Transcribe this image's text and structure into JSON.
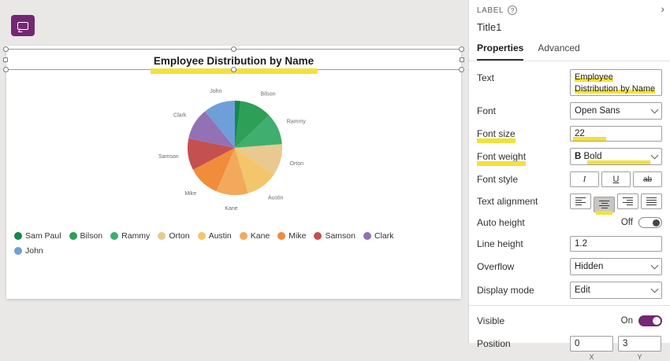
{
  "colors": {
    "accent": "#742774",
    "highlight": "#f2e13c",
    "toggle_on": "#742774"
  },
  "canvas": {
    "title": "Employee Distribution by Name"
  },
  "chart_data": {
    "type": "pie",
    "title": "Employee Distribution by Name",
    "labels": [
      "Sam Paul",
      "Bilson",
      "Rammy",
      "Orton",
      "Austin",
      "Kane",
      "Mike",
      "Samson",
      "Clark",
      "John"
    ],
    "values": [
      2,
      11,
      11,
      11,
      11,
      11,
      11,
      11,
      11,
      11
    ],
    "colors": [
      "#118a4e",
      "#2d9f57",
      "#3fae6e",
      "#e9c98f",
      "#f3c66b",
      "#f2a95c",
      "#f08c3a",
      "#c4504f",
      "#9271b5",
      "#6f9fd8"
    ],
    "legend_position": "bottom-left",
    "slice_labels_shown": [
      "Bilson",
      "Rammy",
      "Orton",
      "Austin",
      "Kane",
      "Mike",
      "Samson",
      "Clark",
      "John"
    ]
  },
  "panel": {
    "collapse_chevron": "›",
    "header": "LABEL",
    "help_icon": "?",
    "control_name": "Title1",
    "tabs": [
      {
        "label": "Properties",
        "active": true
      },
      {
        "label": "Advanced",
        "active": false
      }
    ],
    "fields": {
      "text": {
        "label": "Text",
        "value": "Employee Distribution by Name"
      },
      "font": {
        "label": "Font",
        "value": "Open Sans"
      },
      "font_size": {
        "label": "Font size",
        "value": "22"
      },
      "font_weight": {
        "label": "Font weight",
        "value": "Bold",
        "icon": "B"
      },
      "font_style": {
        "label": "Font style",
        "italic": "I",
        "underline": "U",
        "strike": "ab"
      },
      "text_alignment": {
        "label": "Text alignment",
        "selected_index": 1
      },
      "auto_height": {
        "label": "Auto height",
        "value": "Off"
      },
      "line_height": {
        "label": "Line height",
        "value": "1.2"
      },
      "overflow": {
        "label": "Overflow",
        "value": "Hidden"
      },
      "display_mode": {
        "label": "Display mode",
        "value": "Edit"
      },
      "visible": {
        "label": "Visible",
        "value": "On"
      },
      "position": {
        "label": "Position",
        "x_value": "0",
        "y_value": "3",
        "x_label": "X",
        "y_label": "Y"
      }
    }
  }
}
